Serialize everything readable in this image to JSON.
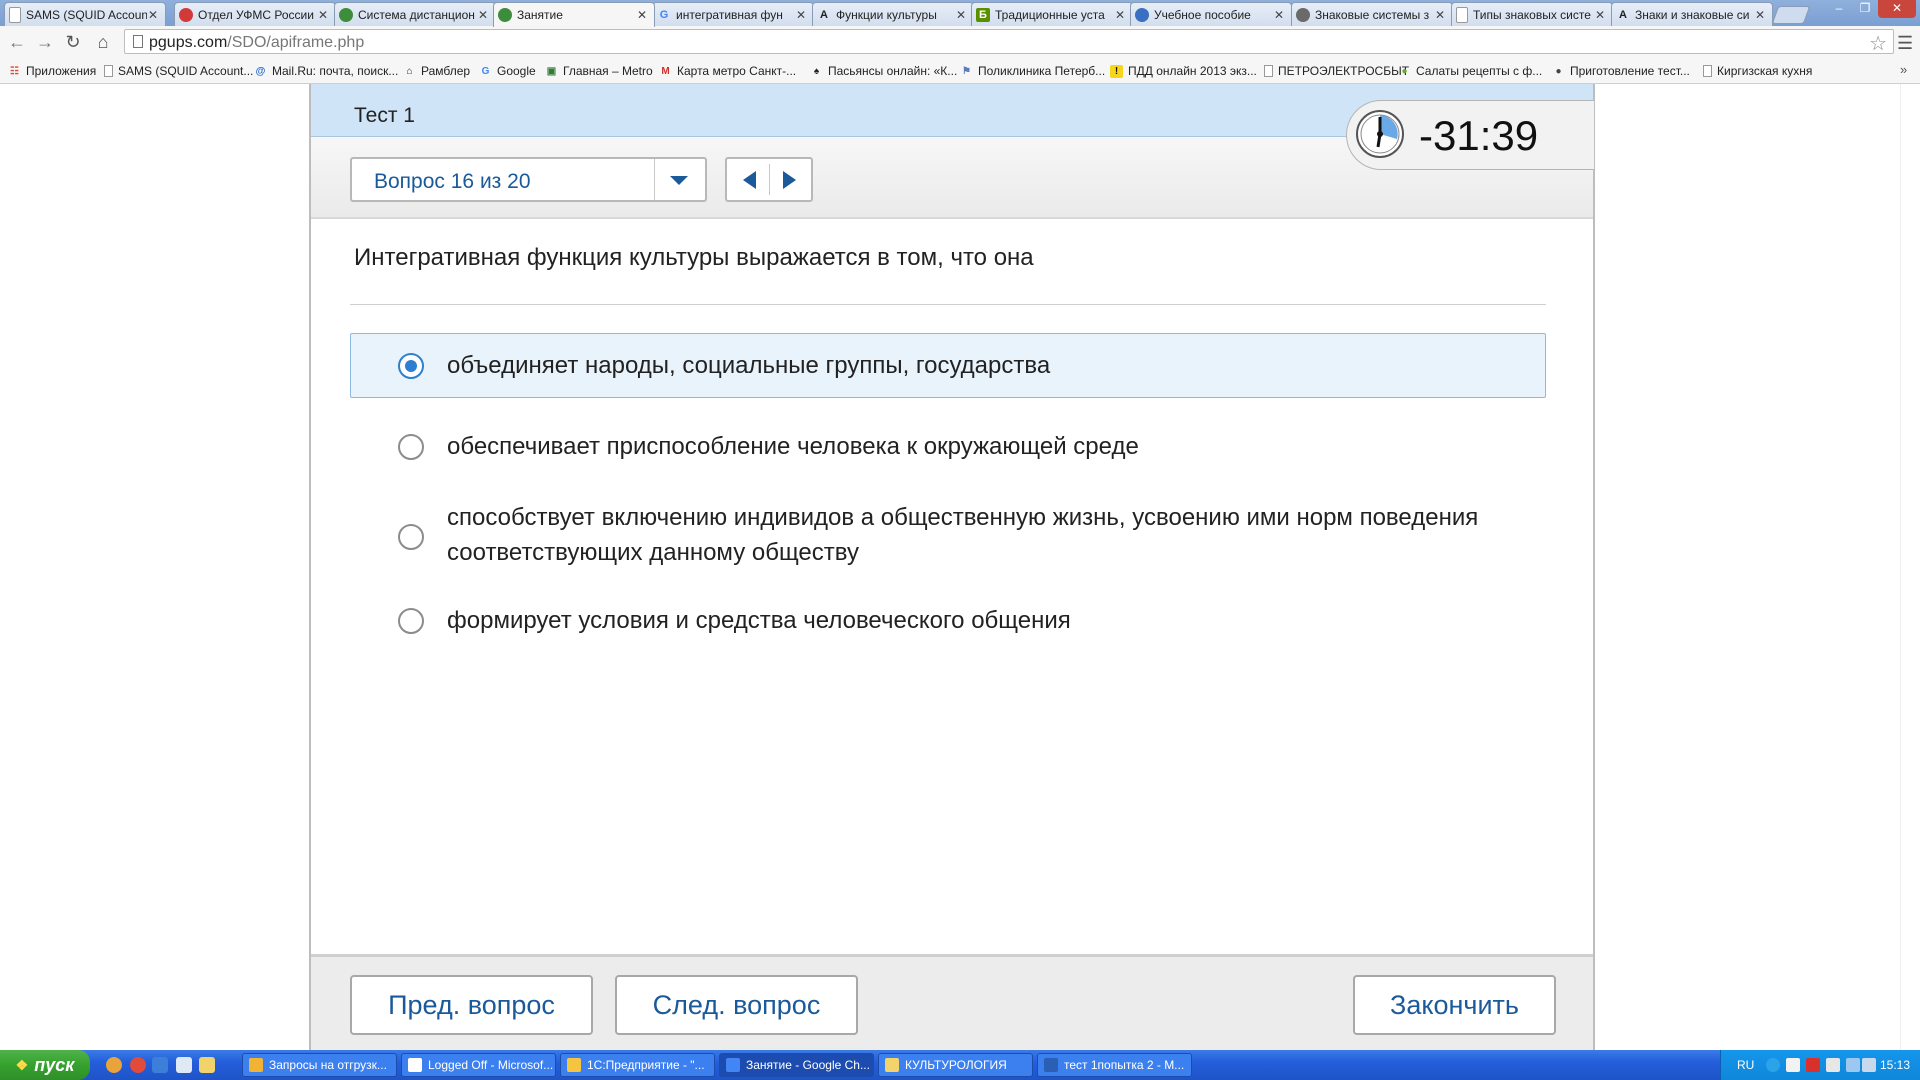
{
  "browser": {
    "tabs": [
      {
        "title": "SAMS (SQUID Accoun",
        "icon": "document-icon",
        "color": "#ffffff",
        "active": false
      },
      {
        "title": "Отдел УФМС России",
        "icon": "emblem-icon",
        "color": "#d23a3a",
        "active": false
      },
      {
        "title": "Система дистанцион",
        "icon": "globe-green-icon",
        "color": "#3c8d3c",
        "active": false
      },
      {
        "title": "Занятие",
        "icon": "globe-green-icon",
        "color": "#3c8d3c",
        "active": true
      },
      {
        "title": "интегративная фун",
        "icon": "google-icon",
        "color": "#4285f4",
        "active": false
      },
      {
        "title": "Функции культуры",
        "icon": "letter-a-icon",
        "color": "#222222",
        "active": false
      },
      {
        "title": "Традиционные уста",
        "icon": "letter-b-icon",
        "color": "#5a8f00",
        "active": false
      },
      {
        "title": "Учебное пособие",
        "icon": "globe-icon",
        "color": "#3b6fc2",
        "active": false
      },
      {
        "title": "Знаковые системы з",
        "icon": "chart-icon",
        "color": "#6a6a6a",
        "active": false
      },
      {
        "title": "Типы знаковых систе",
        "icon": "document-icon",
        "color": "#ffffff",
        "active": false
      },
      {
        "title": "Знаки и знаковые си",
        "icon": "letter-a-icon",
        "color": "#222222",
        "active": false
      }
    ],
    "url_host": "pgups.com",
    "url_path": "/SDO/apiframe.php",
    "bookmarks": [
      {
        "label": "Приложения",
        "icon": "apps-grid-icon"
      },
      {
        "label": "SAMS (SQUID Account...",
        "icon": "document-icon"
      },
      {
        "label": "Mail.Ru: почта, поиск...",
        "icon": "mail-icon"
      },
      {
        "label": "Рамблер",
        "icon": "home-icon"
      },
      {
        "label": "Google",
        "icon": "google-icon"
      },
      {
        "label": "Главная – Metro",
        "icon": "metro-icon"
      },
      {
        "label": "Карта метро Санкт-...",
        "icon": "metro-m-icon"
      },
      {
        "label": "Пасьянсы онлайн: «К...",
        "icon": "spade-icon"
      },
      {
        "label": "Поликлиника Петерб...",
        "icon": "clinic-icon"
      },
      {
        "label": "ПДД онлайн 2013 экз...",
        "icon": "warning-icon"
      },
      {
        "label": "ПЕТРОЭЛЕКТРОСБЫТ",
        "icon": "document-icon"
      },
      {
        "label": "Салаты рецепты с ф...",
        "icon": "leaf-icon"
      },
      {
        "label": "Приготовление тест...",
        "icon": "pot-icon"
      },
      {
        "label": "Киргизская кухня",
        "icon": "document-icon"
      }
    ]
  },
  "quiz": {
    "title": "Тест 1",
    "question_selector": "Вопрос 16 из 20",
    "timer": "-31:39",
    "question": "Интегративная функция культуры выражается в том, что она",
    "options": [
      {
        "label": "объединяет народы, социальные группы, государства",
        "selected": true
      },
      {
        "label": "обеспечивает приспособление человека к окружающей среде",
        "selected": false
      },
      {
        "label": "способствует  включению индивидов а общественную жизнь, усвоению ими норм поведения соответствующих данному обществу",
        "selected": false
      },
      {
        "label": "формирует условия и средства человеческого общения",
        "selected": false
      }
    ],
    "footer": {
      "prev": "Пред. вопрос",
      "next": "След. вопрос",
      "finish": "Закончить"
    },
    "accent_color": "#1b5a9a",
    "selected_color": "#2f7fd0"
  },
  "taskbar": {
    "start_label": "пуск",
    "tasks": [
      {
        "label": "Запросы на отгрузк...",
        "color": "#f2b233",
        "active": false
      },
      {
        "label": "Logged Off - Microsof...",
        "color": "#ffffff",
        "active": false
      },
      {
        "label": "1С:Предприятие - \"...",
        "color": "#f5c542",
        "active": false
      },
      {
        "label": "Занятие - Google Ch...",
        "color": "#4285f4",
        "active": true
      },
      {
        "label": "КУЛЬТУРОЛОГИЯ",
        "color": "#f3d36b",
        "active": false
      },
      {
        "label": "тест 1попытка 2 - M...",
        "color": "#2b5fb5",
        "active": false
      }
    ],
    "language": "RU",
    "clock": "15:13"
  }
}
